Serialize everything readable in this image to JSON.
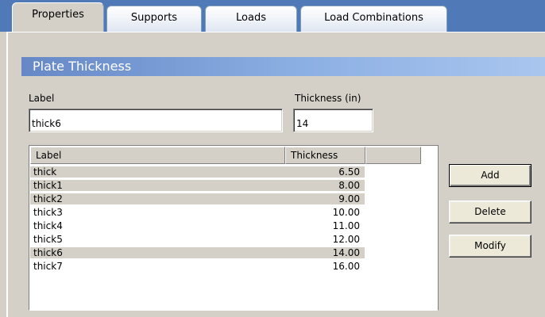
{
  "tabs": [
    {
      "label": "Properties",
      "active": true
    },
    {
      "label": "Supports",
      "active": false
    },
    {
      "label": "Loads",
      "active": false
    },
    {
      "label": "Load Combinations",
      "active": false
    }
  ],
  "section": {
    "title": "Plate Thickness"
  },
  "form": {
    "label_caption": "Label",
    "label_value": "thick6",
    "thickness_caption": "Thickness (in)",
    "thickness_value": "14"
  },
  "table": {
    "columns": [
      "Label",
      "Thickness"
    ],
    "rows": [
      {
        "label": "thick",
        "thickness": "6.50",
        "selected": true
      },
      {
        "label": "thick1",
        "thickness": "8.00",
        "selected": true
      },
      {
        "label": "thick2",
        "thickness": "9.00",
        "selected": true
      },
      {
        "label": "thick3",
        "thickness": "10.00",
        "selected": false
      },
      {
        "label": "thick4",
        "thickness": "11.00",
        "selected": false
      },
      {
        "label": "thick5",
        "thickness": "12.00",
        "selected": false
      },
      {
        "label": "thick6",
        "thickness": "14.00",
        "selected": true
      },
      {
        "label": "thick7",
        "thickness": "16.00",
        "selected": false
      }
    ]
  },
  "buttons": {
    "add": "Add",
    "delete": "Delete",
    "modify": "Modify"
  },
  "colors": {
    "tab_strip": "#4f79b7",
    "header_gradient_start": "#6688c6",
    "panel": "#d4d0c8"
  }
}
